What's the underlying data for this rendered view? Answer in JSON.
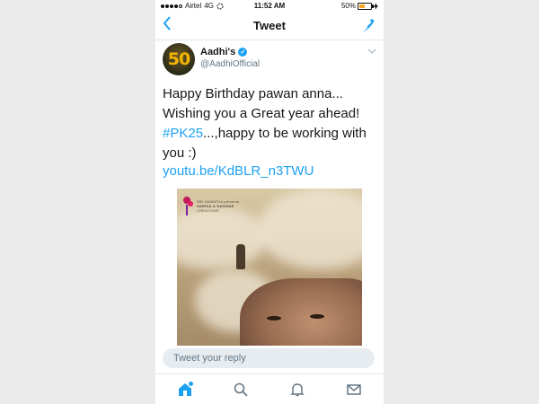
{
  "status_bar": {
    "carrier": "Airtel",
    "network": "4G",
    "time": "11:52 AM",
    "battery_text": "50%",
    "battery_level": 0.5
  },
  "nav": {
    "back_icon": "chevron-left-icon",
    "title": "Tweet",
    "compose_icon": "compose-quill-icon"
  },
  "tweet": {
    "display_name": "Aadhi's",
    "handle": "@AadhiOfficial",
    "avatar_text": "50",
    "line1": "Happy Birthday pawan anna...",
    "line2": "Wishing you a Great year ahead!",
    "hashtag": "#PK25",
    "line3_rest": "...,happy to be working with",
    "line4": "you :)",
    "link": "youtu.be/KdBLR_n3TWU"
  },
  "poster": {
    "credit_line1": "SRI HAMATHA presents",
    "credit_line2": "HARIKA & HASSINE",
    "credit_line3": "CREATIONS"
  },
  "reply": {
    "placeholder": "Tweet your reply"
  },
  "tabbar": {
    "items": [
      "home-icon",
      "search-icon",
      "notifications-icon",
      "messages-icon"
    ]
  },
  "colors": {
    "accent": "#1da1f2",
    "text": "#14171a",
    "muted": "#657786"
  }
}
